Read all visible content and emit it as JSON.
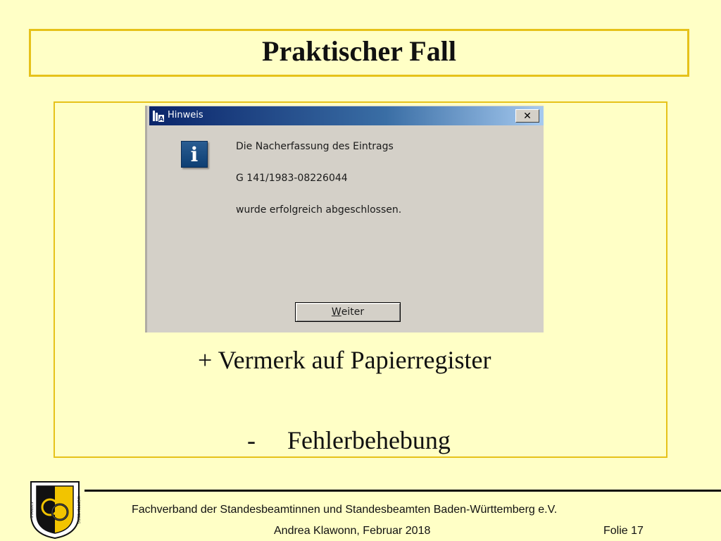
{
  "slide": {
    "title": "Praktischer Fall",
    "line1": "+ Vermerk auf Papierregister",
    "line2_dash": "-",
    "line2_text": "Fehlerbehebung"
  },
  "dialog": {
    "title": "Hinweis",
    "close_label": "✕",
    "icon": "info-icon",
    "icon_glyph": "i",
    "message_line1": "Die Nacherfassung des Eintrags",
    "message_line2": "G 141/1983-08226044",
    "message_line3": "wurde erfolgreich abgeschlossen.",
    "button_mnemonic": "W",
    "button_rest": "eiter"
  },
  "footer": {
    "organization": "Fachverband der Standesbeamtinnen und Standesbeamten Baden-Württemberg e.V.",
    "author_date": "Andrea Klawonn, Februar 2018",
    "slide_number": "Folie 17",
    "emblem_text": "STANDESBEAMTE BADEN-WÜRTTEMBERG"
  },
  "colors": {
    "background": "#ffffc6",
    "border": "#e6c21a",
    "titlebar": "#0a246a",
    "dialog_face": "#d4d0c8"
  }
}
